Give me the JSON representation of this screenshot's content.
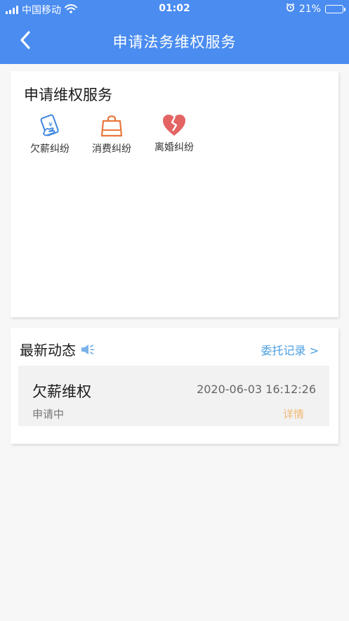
{
  "status_bar": {
    "carrier": "中国移动",
    "time": "01:02",
    "battery": "21%",
    "battery_level": 0.21,
    "icons": [
      "signal-icon",
      "wifi-icon",
      "alarm-icon",
      "battery-icon"
    ]
  },
  "header": {
    "title": "申请法务维权服务",
    "back_icon": "chevron-left-icon",
    "color": "#4a8cf0"
  },
  "services": {
    "title": "申请维权服务",
    "items": [
      {
        "label": "欠薪纠纷",
        "icon": "money-hand-icon",
        "color": "#3e86de"
      },
      {
        "label": "消费纠纷",
        "icon": "shopping-bag-icon",
        "color": "#e8783c"
      },
      {
        "label": "离婚纠纷",
        "icon": "broken-heart-icon",
        "color": "#e46464"
      }
    ]
  },
  "news": {
    "title": "最新动态",
    "title_icon": "megaphone-icon",
    "records_link": "委托记录 >",
    "items": [
      {
        "title": "欠薪维权",
        "time": "2020-06-03 16:12:26",
        "status": "申请中",
        "detail": "详情"
      }
    ]
  }
}
